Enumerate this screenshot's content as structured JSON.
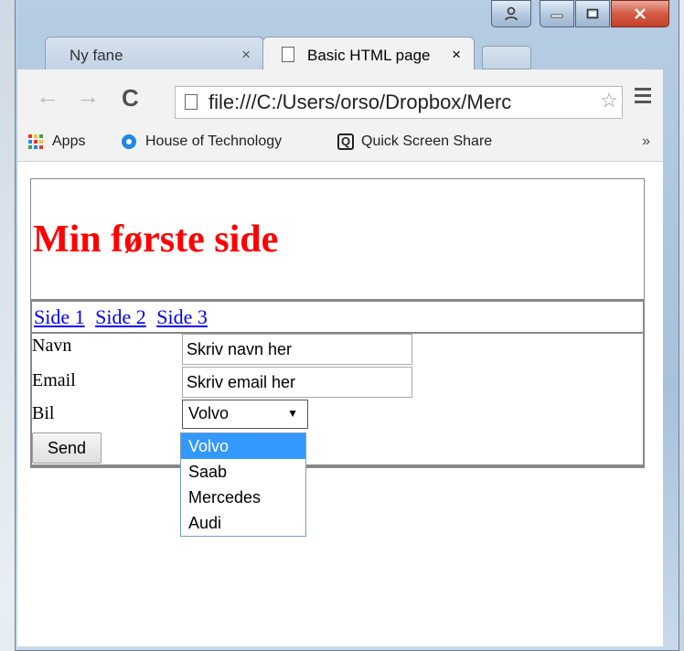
{
  "browser": {
    "tabs": [
      {
        "label": "Ny fane",
        "close": "×"
      },
      {
        "label": "Basic HTML page",
        "close": "×"
      }
    ],
    "address": "file:///C:/Users/orso/Dropbox/Merc",
    "nav": {
      "back": "←",
      "forward": "→",
      "reload": "C",
      "star": "☆"
    },
    "bookmarks": [
      {
        "label": "Apps"
      },
      {
        "label": "House of Technology"
      },
      {
        "label": "Quick Screen Share"
      }
    ],
    "overflow": "»"
  },
  "page": {
    "heading": "Min første side",
    "nav_links": [
      "Side 1",
      "Side 2",
      "Side 3"
    ],
    "form": {
      "name_label": "Navn",
      "name_value": "Skriv navn her",
      "email_label": "Email",
      "email_value": "Skriv email her",
      "car_label": "Bil",
      "car_selected": "Volvo",
      "car_options": [
        "Volvo",
        "Saab",
        "Mercedes",
        "Audi"
      ],
      "submit_label": "Send"
    }
  },
  "colors": {
    "heading": "#ff0000",
    "link": "#0000ee",
    "option_highlight": "#3399ff"
  }
}
